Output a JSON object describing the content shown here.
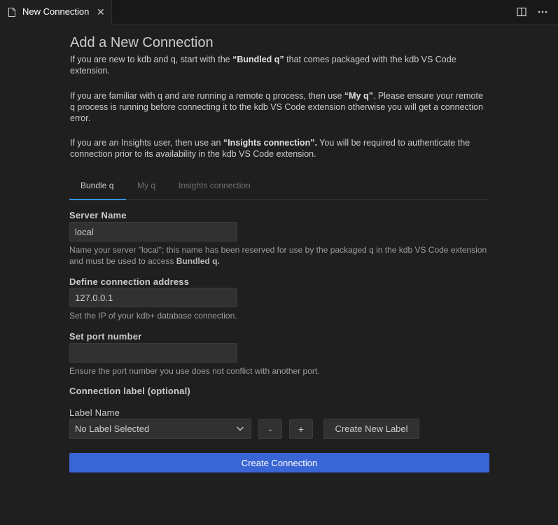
{
  "tab": {
    "title": "New Connection"
  },
  "page": {
    "title": "Add a New Connection",
    "intro1": {
      "a": "If you are new to kdb and q, start with the ",
      "b": "“Bundled q”",
      "c": " that comes packaged with the kdb VS Code extension."
    },
    "intro2": {
      "a": "If you are familiar with q and are running a remote q process, then use ",
      "b": "“My q”",
      "c": ". Please ensure your remote q process is running before connecting it to the kdb VS Code extension otherwise you will get a connection error."
    },
    "intro3": {
      "a": "If you are an Insights user, then use an ",
      "b": "“Insights connection”.",
      "c": " You will be required to authenticate the connection prior to its availability in the kdb VS Code extension."
    }
  },
  "connection_tabs": [
    {
      "label": "Bundle q",
      "active": true
    },
    {
      "label": "My q",
      "active": false
    },
    {
      "label": "Insights connection",
      "active": false
    }
  ],
  "server_name": {
    "label": "Server Name",
    "value": "local",
    "help_a": "Name your server \"local\"; this name has been reserved for use by the packaged q in the kdb VS Code extension and must be used to access ",
    "help_b": "Bundled q."
  },
  "address": {
    "label": "Define connection address",
    "value": "127.0.0.1",
    "help": "Set the IP of your kdb+ database connection."
  },
  "port": {
    "label": "Set port number",
    "value": "",
    "help": "Ensure the port number you use does not conflict with another port."
  },
  "connection_label": {
    "heading": "Connection label (optional)",
    "name_label": "Label Name",
    "selected": "No Label Selected",
    "remove_label": "-",
    "add_label": "+",
    "create_label": "Create New Label"
  },
  "submit": {
    "label": "Create Connection"
  },
  "colors": {
    "accent": "#3794ff",
    "primary_button": "#3a65d4",
    "background": "#1f1f1f"
  }
}
